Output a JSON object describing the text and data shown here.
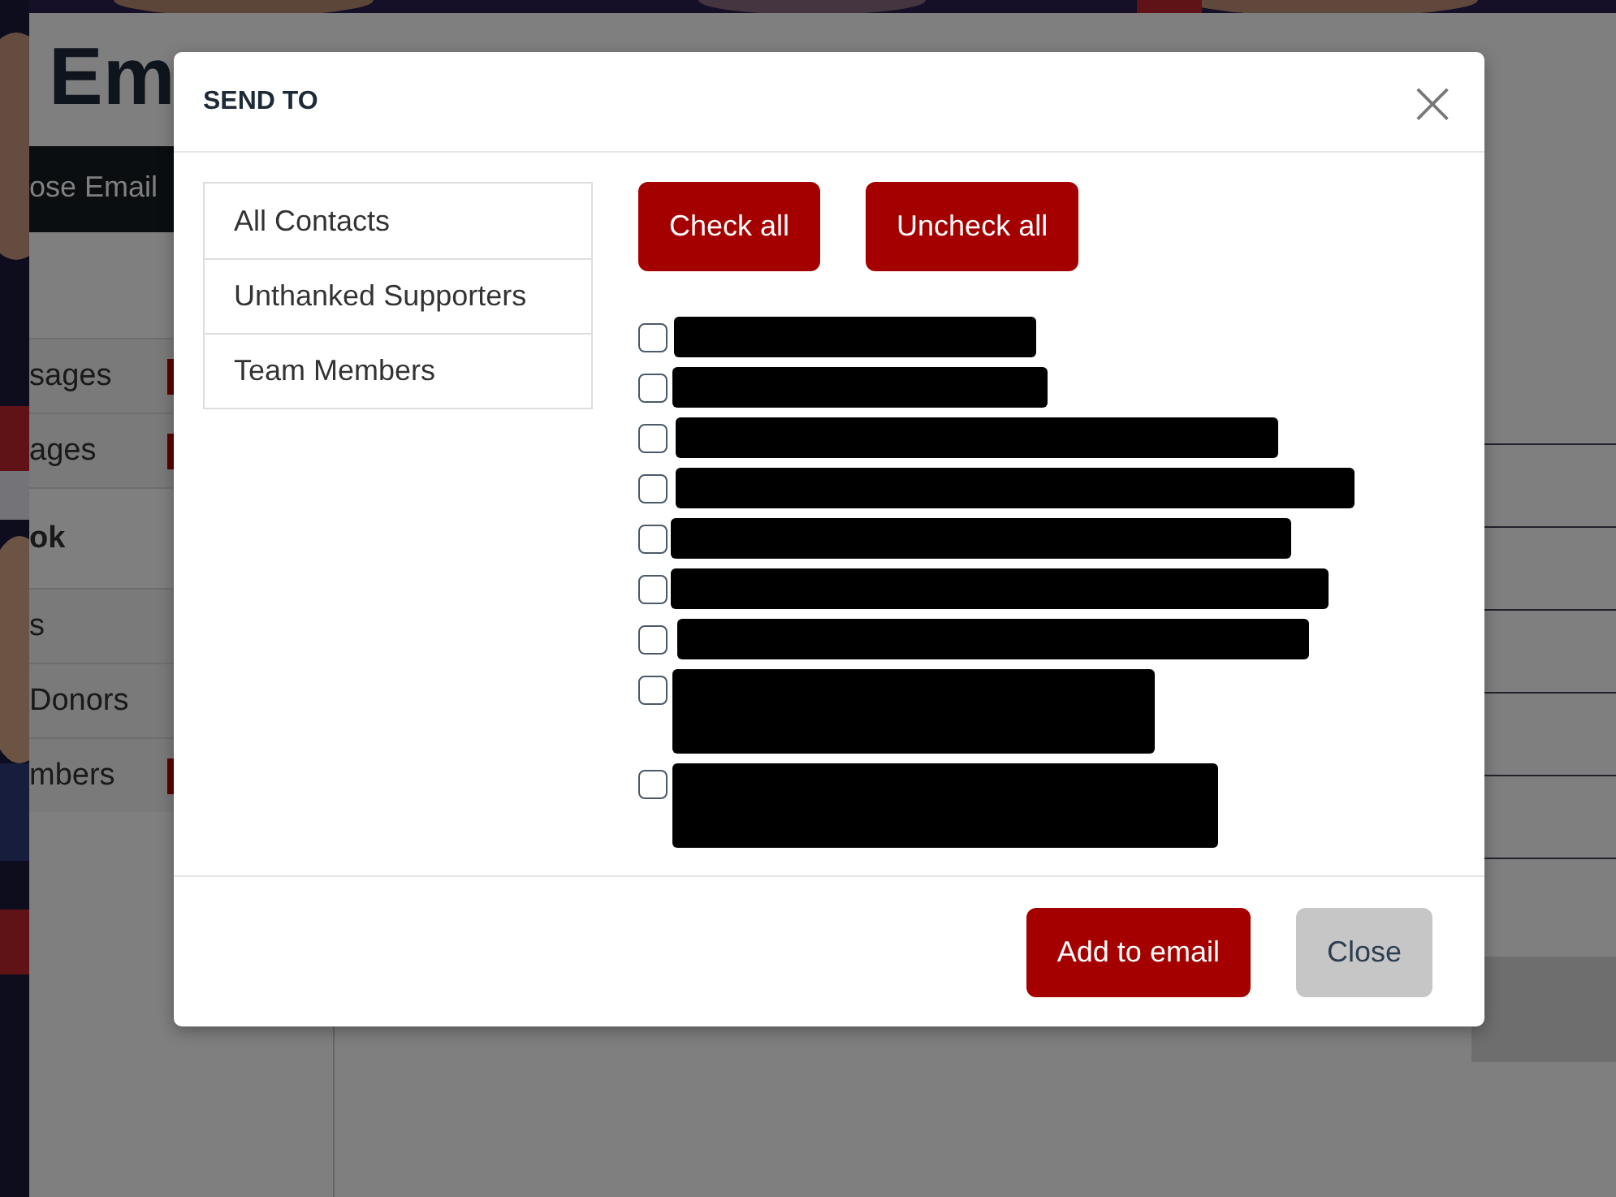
{
  "page": {
    "title": "Em",
    "compose_button": "ose Email",
    "sidebar": [
      {
        "label": "sages",
        "flag": true,
        "bold": false
      },
      {
        "label": "ages",
        "flag": true,
        "bold": false
      },
      {
        "label": "ok",
        "flag": false,
        "bold": true
      },
      {
        "label": "s",
        "flag": false,
        "bold": false
      },
      {
        "label": "Donors",
        "flag": false,
        "bold": false
      },
      {
        "label": "mbers",
        "flag": true,
        "bold": false
      }
    ]
  },
  "modal": {
    "title": "SEND TO",
    "close_icon": "×",
    "groups": [
      {
        "label": "All Contacts",
        "selected": false
      },
      {
        "label": "Unthanked Supporters",
        "selected": false
      },
      {
        "label": "Team Members",
        "selected": false
      }
    ],
    "check_all": "Check all",
    "uncheck_all": "Uncheck all",
    "contacts": [
      {
        "checked": false,
        "kind": "short"
      },
      {
        "checked": false,
        "kind": "short"
      },
      {
        "checked": false,
        "kind": "short"
      },
      {
        "checked": false,
        "kind": "short"
      },
      {
        "checked": false,
        "kind": "short"
      },
      {
        "checked": false,
        "kind": "short"
      },
      {
        "checked": false,
        "kind": "short"
      },
      {
        "checked": false,
        "kind": "tall"
      },
      {
        "checked": false,
        "kind": "tall"
      }
    ],
    "buttons": [
      {
        "label": "Add to email",
        "kind": "primary"
      },
      {
        "label": "Close",
        "kind": "secondary"
      }
    ]
  }
}
